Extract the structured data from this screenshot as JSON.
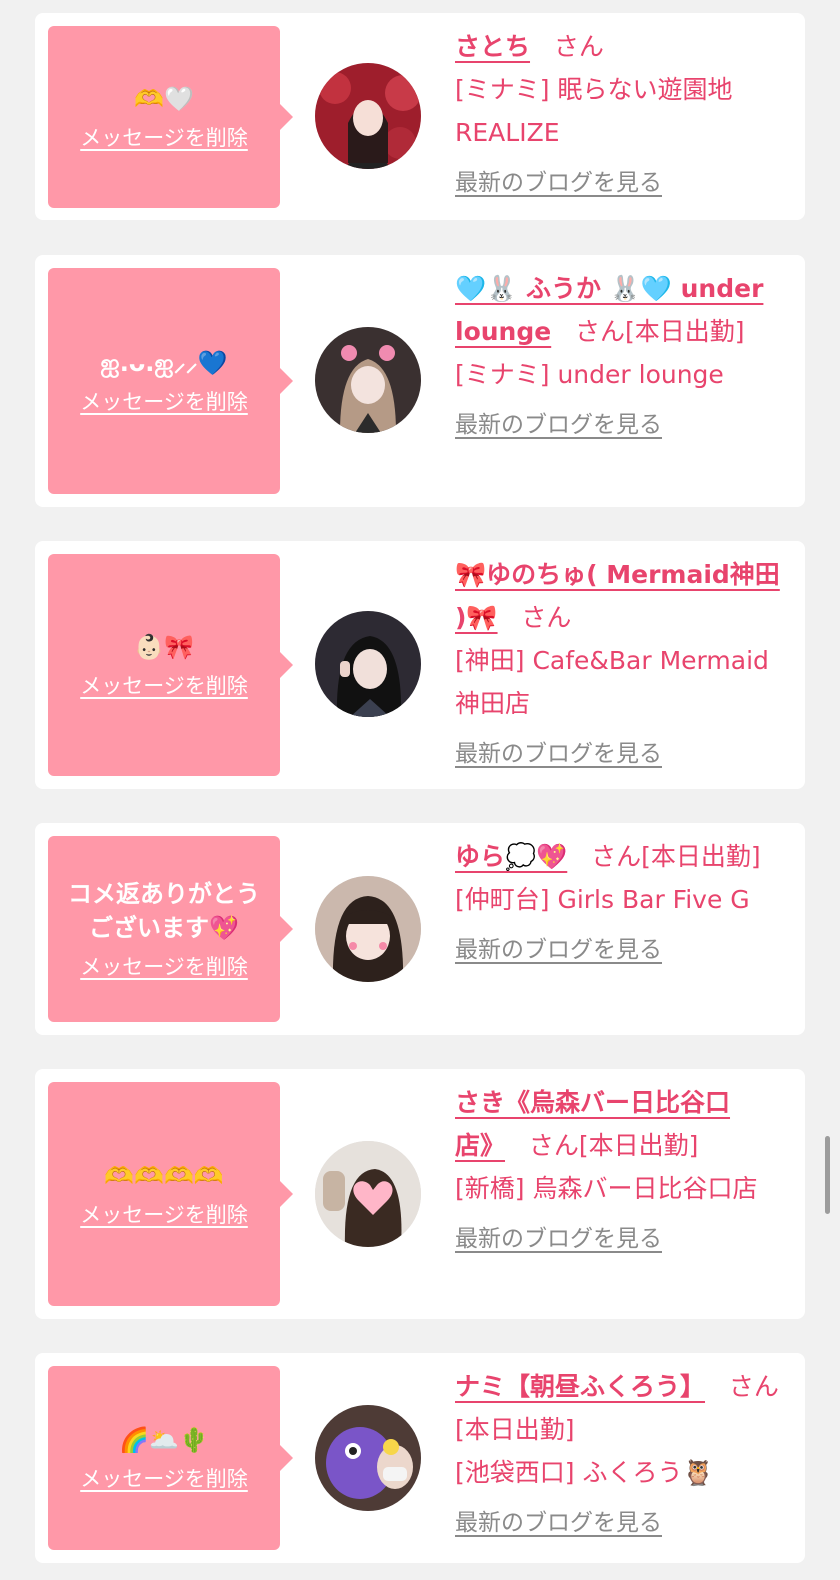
{
  "entries": [
    {
      "message": "🫶🤍",
      "delete_label": "メッセージを削除",
      "name": "さとち",
      "honorific": "さん",
      "location_shop": "[ミナミ] 眠らない遊園地REALIZE",
      "blog_label": "最新のブログを見る"
    },
    {
      "message": "ஐ.ᴗ.ஐ⸝⸝💙",
      "delete_label": "メッセージを削除",
      "name": "🩵🐰 ふうか 🐰🩵 under lounge",
      "honorific": "さん[本日出勤]",
      "location_shop": "[ミナミ] under lounge",
      "blog_label": "最新のブログを見る"
    },
    {
      "message": "👶🏻🎀",
      "delete_label": "メッセージを削除",
      "name": "🎀ゆのちゅ( Mermaid神田 )🎀",
      "honorific": "さん",
      "location_shop": "[神田] Cafe&Bar Mermaid 神田店",
      "blog_label": "最新のブログを見る"
    },
    {
      "message": "コメ返ありがとう\nございます💖",
      "delete_label": "メッセージを削除",
      "name": "ゆら💭💖",
      "honorific": "さん[本日出勤]",
      "location_shop": "[仲町台] Girls Bar Five G",
      "blog_label": "最新のブログを見る"
    },
    {
      "message": "🫶🫶🫶🫶",
      "delete_label": "メッセージを削除",
      "name": "さき《烏森バー日比谷口店》",
      "honorific": "さん[本日出勤]",
      "location_shop": "[新橋] 烏森バー日比谷口店",
      "blog_label": "最新のブログを見る"
    },
    {
      "message": "🌈🌥️🌵",
      "delete_label": "メッセージを削除",
      "name": "ナミ【朝昼ふくろう】",
      "honorific": "さん[本日出勤]",
      "location_shop": "[池袋西口] ふくろう🦉",
      "blog_label": "最新のブログを見る"
    }
  ]
}
